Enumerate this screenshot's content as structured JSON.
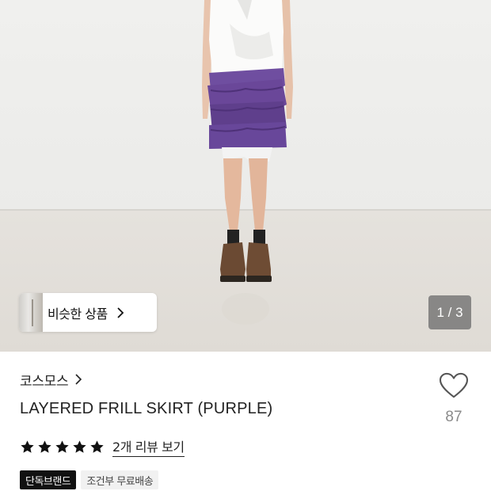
{
  "gallery": {
    "similar_label": "비슷한 상품",
    "counter": "1 / 3"
  },
  "product": {
    "brand": "코스모스",
    "title": "LAYERED FRILL SKIRT (PURPLE)",
    "rating": 5,
    "review_link": "2개 리뷰 보기",
    "like_count": "87",
    "badges": [
      "단독브랜드",
      "조건부 무료배송"
    ]
  },
  "colors": {
    "skirt": "#6b4a9a",
    "badge_dark": "#111111"
  }
}
